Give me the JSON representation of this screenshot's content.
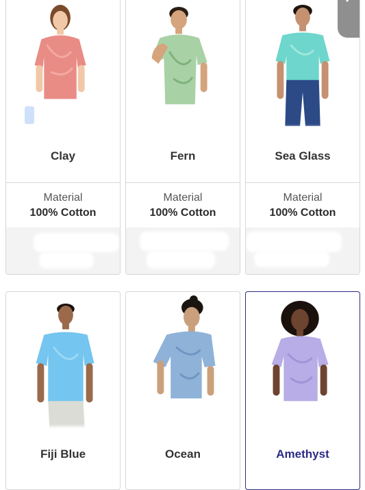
{
  "products": [
    {
      "name": "Clay",
      "material_label": "Material",
      "material_value": "100% Cotton",
      "shirt_color": "#e98c86",
      "skin": "#f1c8a8",
      "hair": "#7a4a2a",
      "selected": false
    },
    {
      "name": "Fern",
      "material_label": "Material",
      "material_value": "100% Cotton",
      "shirt_color": "#a9d1a6",
      "skin": "#d5a47c",
      "hair": "#2a1d14",
      "selected": false
    },
    {
      "name": "Sea Glass",
      "material_label": "Material",
      "material_value": "100% Cotton",
      "shirt_color": "#6ed6cc",
      "skin": "#c69170",
      "hair": "#1e1510",
      "selected": false
    },
    {
      "name": "Fiji Blue",
      "shirt_color": "#74c5ef",
      "skin": "#9a6a4a",
      "hair": "#1a120d",
      "selected": false
    },
    {
      "name": "Ocean",
      "shirt_color": "#8fb2d8",
      "skin": "#caa07c",
      "hair": "#1a1410",
      "selected": false
    },
    {
      "name": "Amethyst",
      "shirt_color": "#b8ade6",
      "skin": "#6d4430",
      "hair": "#1a110c",
      "selected": true
    }
  ],
  "colors": {
    "selected_border": "#2b2a86",
    "card_border": "#d7d7d7",
    "name_text": "#333333"
  }
}
